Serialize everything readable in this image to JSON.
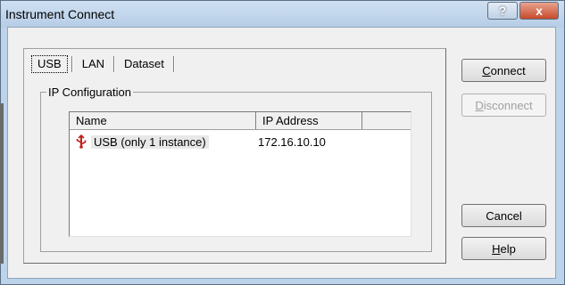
{
  "window": {
    "title": "Instrument Connect"
  },
  "titlebar": {
    "help_glyph": "?",
    "close_glyph": "x"
  },
  "tabs": [
    {
      "label": "USB"
    },
    {
      "label": "LAN"
    },
    {
      "label": "Dataset"
    }
  ],
  "group": {
    "label": "IP Configuration"
  },
  "list": {
    "columns": [
      "Name",
      "IP Address"
    ],
    "rows": [
      {
        "icon": "usb-icon",
        "name": "USB (only 1 instance)",
        "ip": "172.16.10.10"
      }
    ]
  },
  "buttons": {
    "connect": {
      "mnemonic": "C",
      "rest": "onnect"
    },
    "disconnect": {
      "mnemonic": "D",
      "rest": "isconnect"
    },
    "cancel": "Cancel",
    "help": {
      "mnemonic": "H",
      "rest": "elp"
    }
  }
}
